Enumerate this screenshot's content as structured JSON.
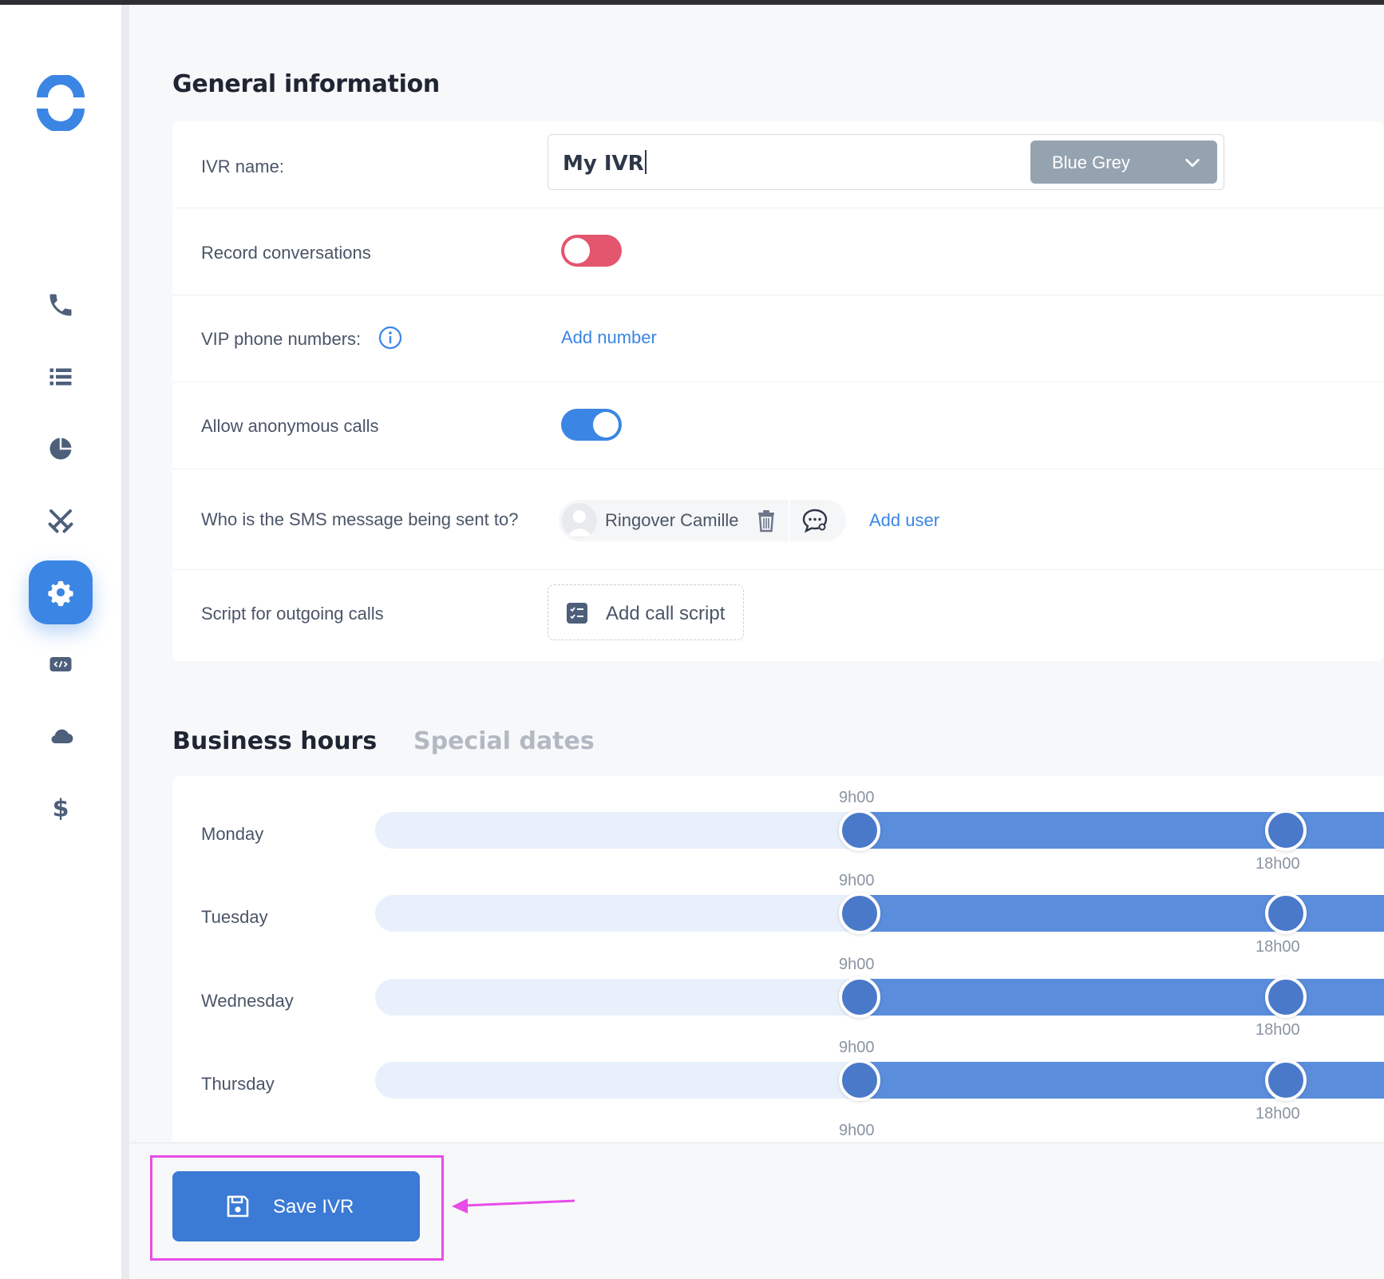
{
  "sidebar": {
    "logo": "ringover-logo",
    "items": [
      {
        "icon": "phone-icon",
        "active": false
      },
      {
        "icon": "list-icon",
        "active": false
      },
      {
        "icon": "pie-chart-icon",
        "active": false
      },
      {
        "icon": "crossed-swords-icon",
        "active": false
      },
      {
        "icon": "gear-icon",
        "active": true
      },
      {
        "icon": "code-icon",
        "active": false
      },
      {
        "icon": "cloud-icon",
        "active": false
      },
      {
        "icon": "dollar-icon",
        "active": false
      }
    ]
  },
  "general": {
    "title": "General information",
    "ivr_name_label": "IVR name:",
    "ivr_name_value": "My IVR",
    "color_value": "Blue Grey",
    "record_label": "Record conversations",
    "record_enabled": false,
    "vip_label": "VIP phone numbers:",
    "vip_add": "Add number",
    "anon_label": "Allow anonymous calls",
    "anon_enabled": true,
    "sms_label": "Who is the SMS message being sent to?",
    "sms_user": "Ringover Camille",
    "sms_add": "Add user",
    "script_label": "Script for outgoing calls",
    "script_add": "Add call script"
  },
  "hours": {
    "tab_business": "Business hours",
    "tab_special": "Special dates",
    "days": [
      {
        "name": "Monday",
        "start": "9h00",
        "end": "18h00"
      },
      {
        "name": "Tuesday",
        "start": "9h00",
        "end": "18h00"
      },
      {
        "name": "Wednesday",
        "start": "9h00",
        "end": "18h00"
      },
      {
        "name": "Thursday",
        "start": "9h00",
        "end": "18h00"
      }
    ],
    "next_start": "9h00"
  },
  "footer": {
    "save_label": "Save IVR"
  },
  "colors": {
    "accent": "#3b86e4",
    "toggle_off": "#e3566e",
    "toggle_on": "#3b86e4",
    "range": "#5a8ddb",
    "annotation": "#e84de8"
  }
}
